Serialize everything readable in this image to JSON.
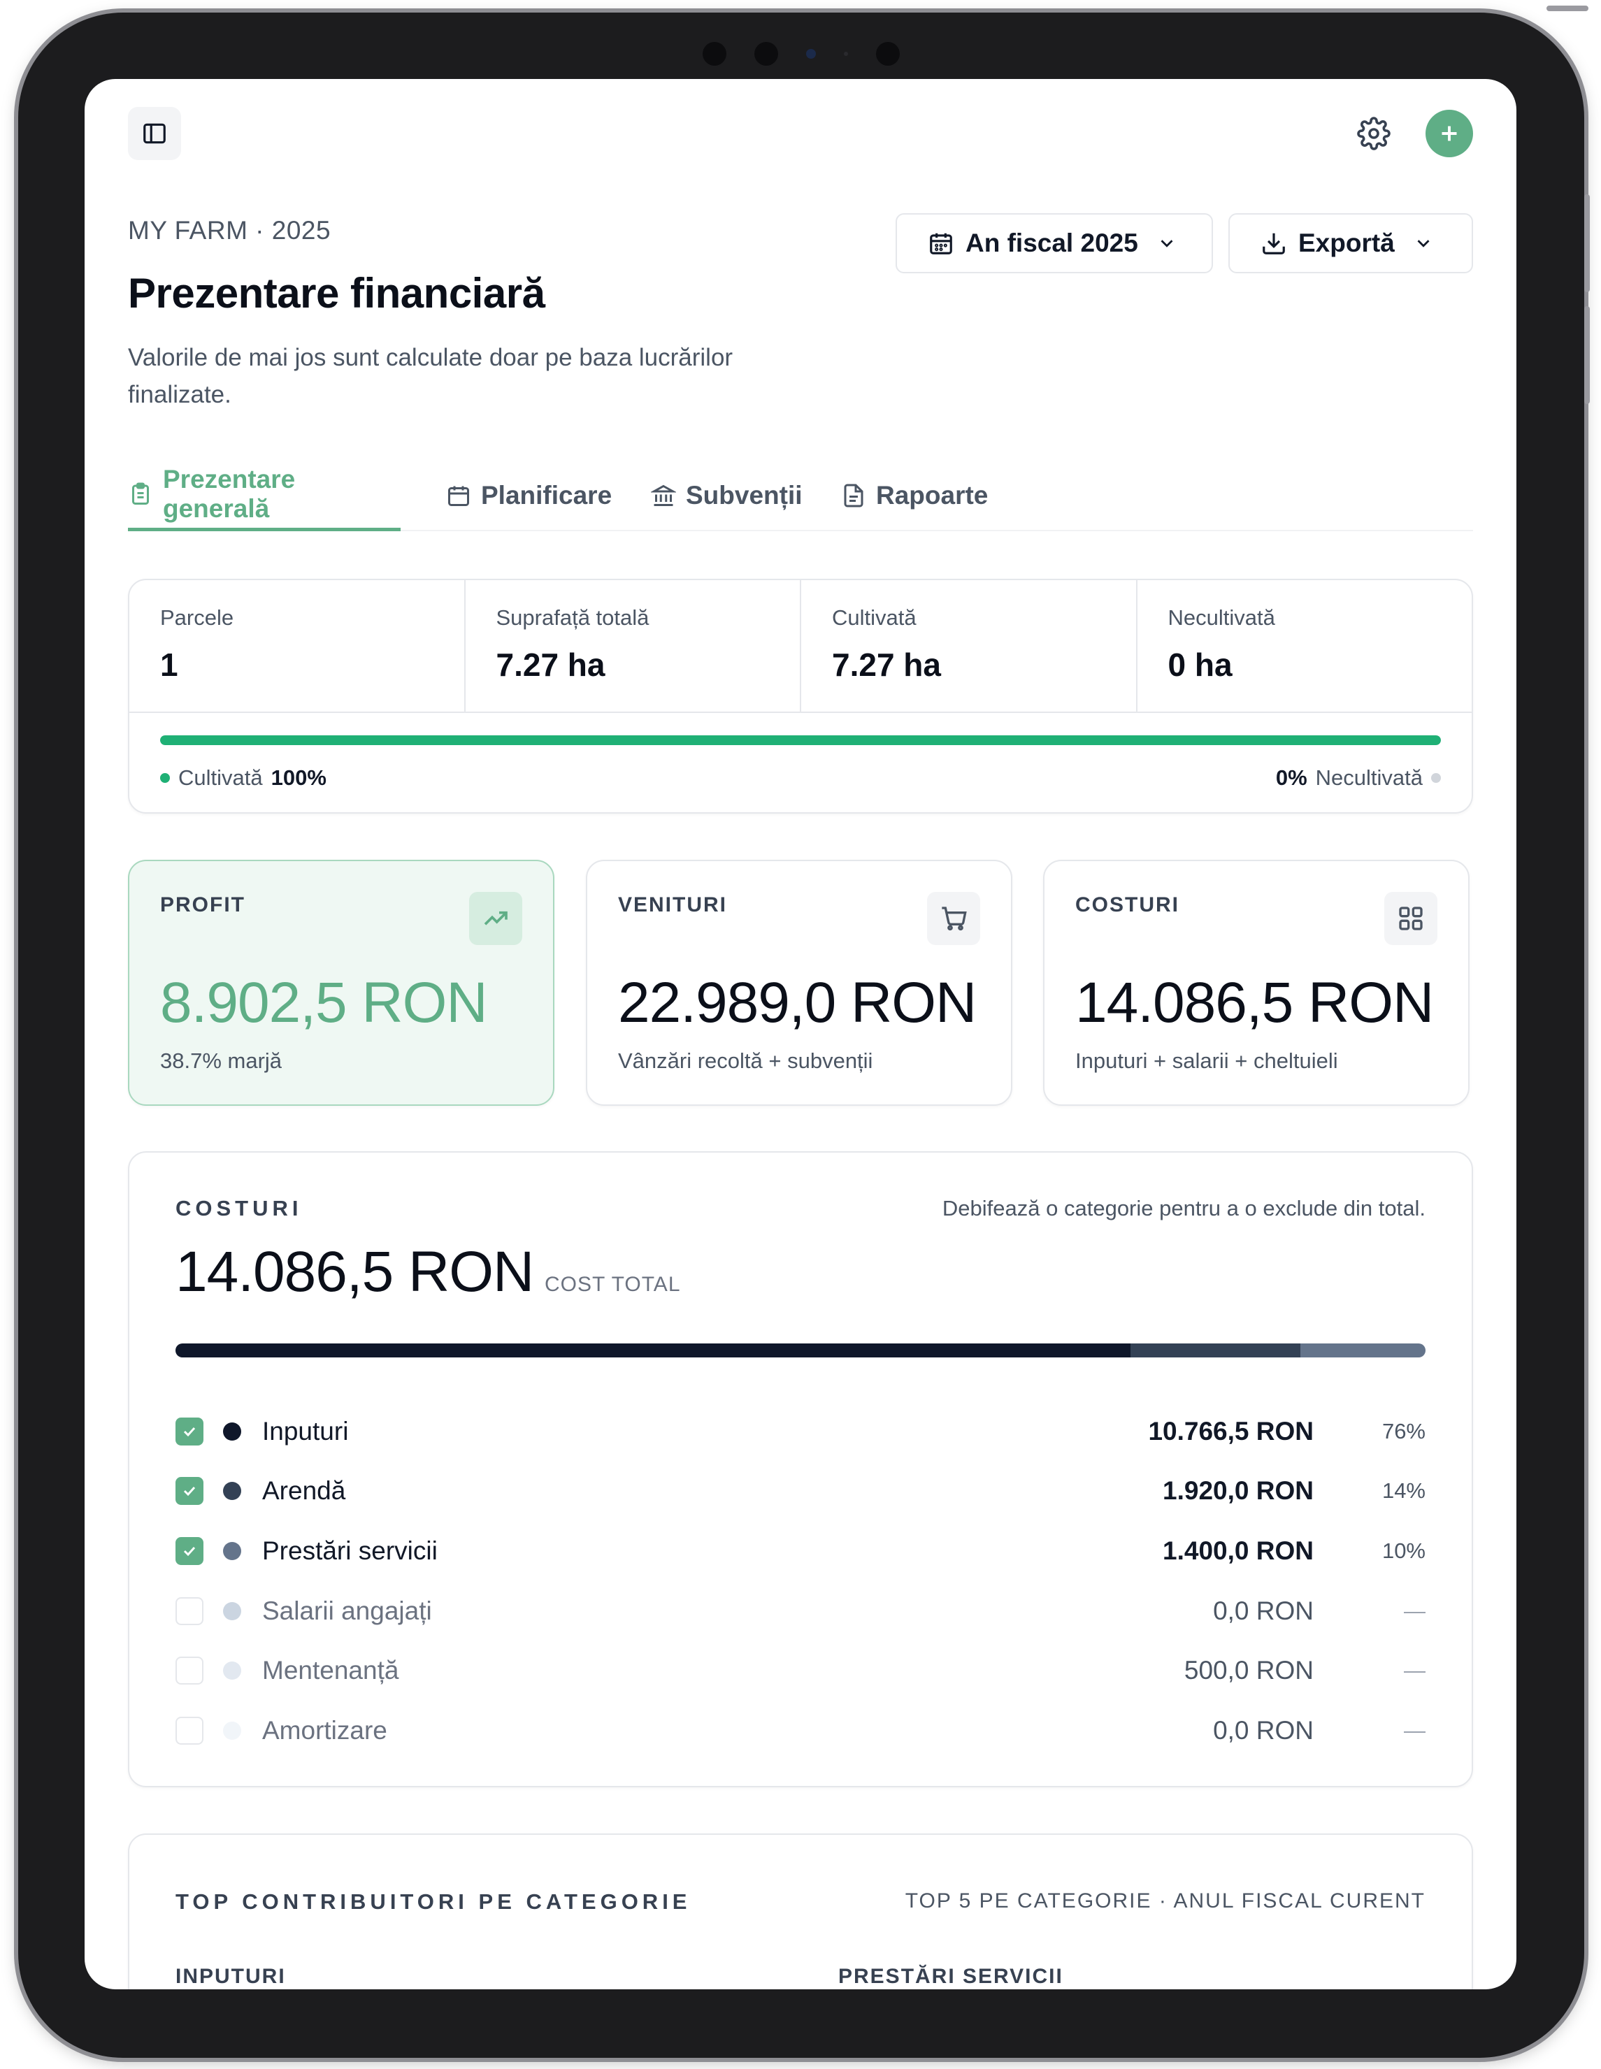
{
  "header": {
    "eyebrow": "MY FARM · 2025",
    "title": "Prezentare financiară",
    "subtitle": "Valorile de mai jos sunt calculate doar pe baza lucrărilor finalizate.",
    "fiscal_button": "An fiscal 2025",
    "export_button": "Exportă"
  },
  "tabs": [
    {
      "label": "Prezentare generală",
      "active": true,
      "icon": "clipboard-icon"
    },
    {
      "label": "Planificare",
      "active": false,
      "icon": "calendar-icon"
    },
    {
      "label": "Subvenții",
      "active": false,
      "icon": "bank-icon"
    },
    {
      "label": "Rapoarte",
      "active": false,
      "icon": "document-icon"
    }
  ],
  "stats": {
    "items": [
      {
        "label": "Parcele",
        "value": "1"
      },
      {
        "label": "Suprafață totală",
        "value": "7.27 ha"
      },
      {
        "label": "Cultivată",
        "value": "7.27 ha"
      },
      {
        "label": "Necultivată",
        "value": "0 ha"
      }
    ],
    "cultivated_fraction": 1.0,
    "cultivated_label": "Cultivată",
    "cultivated_pct": "100%",
    "uncultivated_label": "Necultivată",
    "uncultivated_pct": "0%",
    "colors": {
      "cultivated": "#1fb075",
      "uncultivated": "#d1d5db"
    }
  },
  "metrics": {
    "profit": {
      "label": "PROFIT",
      "value": "8.902,5 RON",
      "sub": "38.7% marjă",
      "icon": "trending-up-icon"
    },
    "revenue": {
      "label": "VENITURI",
      "value": "22.989,0 RON",
      "sub": "Vânzări recoltă + subvenții",
      "icon": "cart-icon"
    },
    "costs": {
      "label": "COSTURI",
      "value": "14.086,5 RON",
      "sub": "Inputuri + salarii + cheltuieli",
      "icon": "grid-icon"
    }
  },
  "costs": {
    "label": "COSTURI",
    "hint": "Debifează o categorie pentru a o exclude din total.",
    "total": "14.086,5 RON",
    "total_label": "COST TOTAL",
    "items": [
      {
        "name": "Inputuri",
        "amount": "10.766,5 RON",
        "pct": "76%",
        "share": 0.764,
        "checked": true,
        "color": "#0f172a"
      },
      {
        "name": "Arendă",
        "amount": "1.920,0 RON",
        "pct": "14%",
        "share": 0.136,
        "checked": true,
        "color": "#334155"
      },
      {
        "name": "Prestări servicii",
        "amount": "1.400,0 RON",
        "pct": "10%",
        "share": 0.1,
        "checked": true,
        "color": "#64748b"
      },
      {
        "name": "Salarii angajați",
        "amount": "0,0 RON",
        "pct": "—",
        "share": 0,
        "checked": false,
        "color": "#cbd5e1"
      },
      {
        "name": "Mentenanță",
        "amount": "500,0 RON",
        "pct": "—",
        "share": 0,
        "checked": false,
        "color": "#e2e8f0"
      },
      {
        "name": "Amortizare",
        "amount": "0,0 RON",
        "pct": "—",
        "share": 0,
        "checked": false,
        "color": "#f1f5f9"
      }
    ]
  },
  "top_contributors": {
    "label": "TOP CONTRIBUITORI PE CATEGORIE",
    "hint": "TOP 5 PE CATEGORIE · ANUL FISCAL CURENT",
    "columns": [
      "INPUTURI",
      "PRESTĂRI SERVICII"
    ]
  },
  "colors": {
    "accent": "#5fae86",
    "profit_bg": "#eff8f3"
  }
}
